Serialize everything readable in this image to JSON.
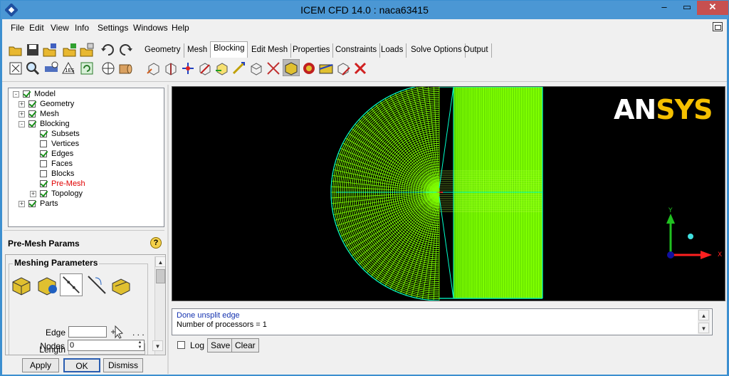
{
  "window": {
    "title": "ICEM CFD 14.0 : naca63415",
    "min_glyph": "–",
    "max_glyph": "▭",
    "close_glyph": "✕"
  },
  "menu": [
    "File",
    "Edit",
    "View",
    "Info",
    "Settings",
    "Windows",
    "Help"
  ],
  "tabs": [
    {
      "label": "Geometry",
      "active": false
    },
    {
      "label": "Mesh",
      "active": false
    },
    {
      "label": "Blocking",
      "active": true
    },
    {
      "label": "Edit Mesh",
      "active": false
    },
    {
      "label": "Properties",
      "active": false
    },
    {
      "label": "Constraints",
      "active": false
    },
    {
      "label": "Loads",
      "active": false
    },
    {
      "label": "Solve Options",
      "active": false
    },
    {
      "label": "Output",
      "active": false
    }
  ],
  "left_toolbar_icons": [
    "open-folder-icon",
    "save-icon",
    "open-geometry-icon",
    "open-mesh-icon",
    "open-blocking-icon",
    "undo-icon",
    "redo-icon",
    "fit-window-icon",
    "zoom-box-icon",
    "measure-icon",
    "hide-icon",
    "refresh-icon",
    "wireframe-icon",
    "solid-icon"
  ],
  "blocking_toolbar_icons": [
    "create-block-icon",
    "split-block-icon",
    "merge-vertices-icon",
    "edit-block-icon",
    "associate-icon",
    "move-vertex-icon",
    "transform-block-icon",
    "edit-edge-icon",
    "premesh-params-icon",
    "premesh-quality-icon",
    "check-blocks-icon",
    "delete-block-icon",
    "delete-item-icon"
  ],
  "tree": [
    {
      "label": "Model",
      "level": 0,
      "expander": "-",
      "checked": true,
      "red": false
    },
    {
      "label": "Geometry",
      "level": 1,
      "expander": "+",
      "checked": true,
      "red": false
    },
    {
      "label": "Mesh",
      "level": 1,
      "expander": "+",
      "checked": true,
      "red": false
    },
    {
      "label": "Blocking",
      "level": 1,
      "expander": "-",
      "checked": true,
      "red": false
    },
    {
      "label": "Subsets",
      "level": 2,
      "expander": "",
      "checked": true,
      "red": false
    },
    {
      "label": "Vertices",
      "level": 2,
      "expander": "",
      "checked": false,
      "red": false
    },
    {
      "label": "Edges",
      "level": 2,
      "expander": "",
      "checked": true,
      "red": false
    },
    {
      "label": "Faces",
      "level": 2,
      "expander": "",
      "checked": false,
      "red": false
    },
    {
      "label": "Blocks",
      "level": 2,
      "expander": "",
      "checked": false,
      "red": false
    },
    {
      "label": "Pre-Mesh",
      "level": 2,
      "expander": "",
      "checked": true,
      "red": true
    },
    {
      "label": "Topology",
      "level": 2,
      "expander": "+",
      "checked": true,
      "red": false
    },
    {
      "label": "Parts",
      "level": 1,
      "expander": "+",
      "checked": true,
      "red": false
    }
  ],
  "params": {
    "title": "Pre-Mesh Params",
    "section": "Meshing Parameters",
    "icons": [
      "update-sizes-icon",
      "scale-sizes-icon",
      "edge-params-icon",
      "match-edges-icon",
      "refinement-icon"
    ],
    "edge_label": "Edge",
    "edge_value": "",
    "edge_more": ". . .",
    "length_label": "Length",
    "length_value": "",
    "nodes_label": "Nodes",
    "nodes_value": "0"
  },
  "buttons": {
    "apply": "Apply",
    "ok": "OK",
    "dismiss": "Dismiss"
  },
  "logo": {
    "part1": "AN",
    "part2": "SYS"
  },
  "axis": {
    "y_label": "Y",
    "x_label": "X"
  },
  "messages": {
    "line1": "Done unsplit edge",
    "line2": "Number of processors = 1"
  },
  "message_controls": {
    "log_label": "Log",
    "log_checked": false,
    "save": "Save",
    "clear": "Clear"
  },
  "colors": {
    "mesh": "#7fff00",
    "mesh_lines": "#00ffcc",
    "axis_x": "#ff2020",
    "axis_y": "#20c020",
    "background": "#000000",
    "titlebar": "#4b97d4",
    "close": "#c75050"
  }
}
